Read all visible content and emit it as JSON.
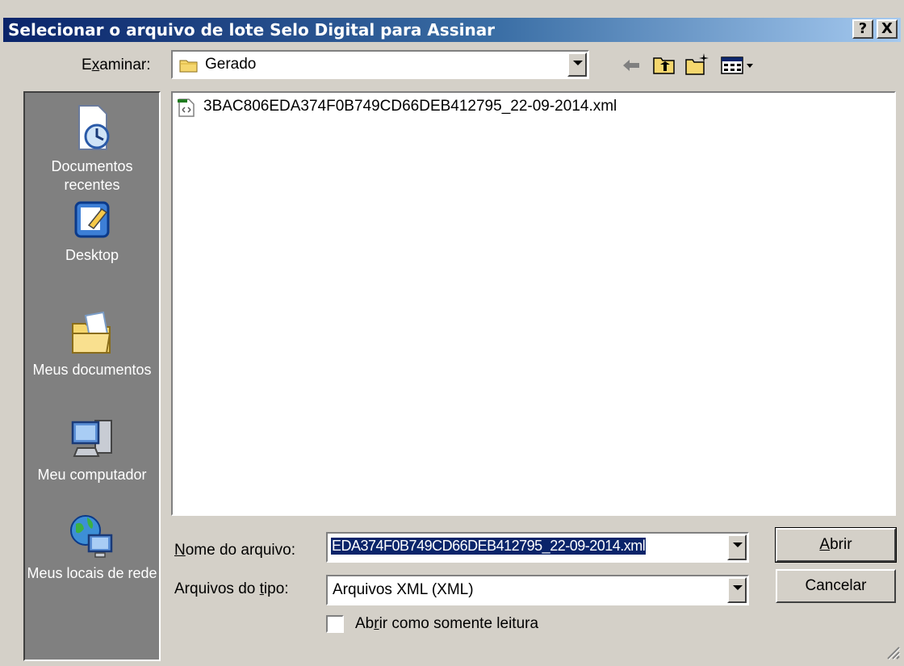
{
  "window": {
    "title": "Selecionar o arquivo de lote Selo Digital para Assinar",
    "help_btn": "?",
    "close_btn": "X"
  },
  "lookin": {
    "label_pre": "E",
    "label_u": "x",
    "label_post": "aminar:",
    "value": "Gerado"
  },
  "toolbar": {
    "icons": [
      "back-arrow-icon",
      "up-folder-icon",
      "new-folder-icon",
      "view-menu-icon"
    ]
  },
  "places": [
    {
      "label": "Documentos recentes",
      "icon": "recent-documents-icon"
    },
    {
      "label": "Desktop",
      "icon": "desktop-icon"
    },
    {
      "label": "Meus documentos",
      "icon": "my-documents-icon"
    },
    {
      "label": "Meu computador",
      "icon": "my-computer-icon"
    },
    {
      "label": "Meus locais de rede",
      "icon": "network-places-icon"
    }
  ],
  "files": [
    {
      "name": "3BAC806EDA374F0B749CD66DEB412795_22-09-2014.xml",
      "icon": "xml-file-icon"
    }
  ],
  "filename": {
    "label_u": "N",
    "label_post": "ome do arquivo:",
    "value": "EDA374F0B749CD66DEB412795_22-09-2014.xml"
  },
  "filetype": {
    "label_pre": "Arquivos do ",
    "label_u": "t",
    "label_post": "ipo:",
    "value": "Arquivos XML (XML)"
  },
  "readonly": {
    "label_pre": "Ab",
    "label_u": "r",
    "label_post": "ir como somente leitura",
    "checked": false
  },
  "buttons": {
    "open_u": "A",
    "open_post": "brir",
    "cancel": "Cancelar"
  },
  "colors": {
    "title_start": "#0a246a",
    "title_end": "#a6caf0",
    "face": "#d4d0c8",
    "selection": "#0a246a"
  }
}
